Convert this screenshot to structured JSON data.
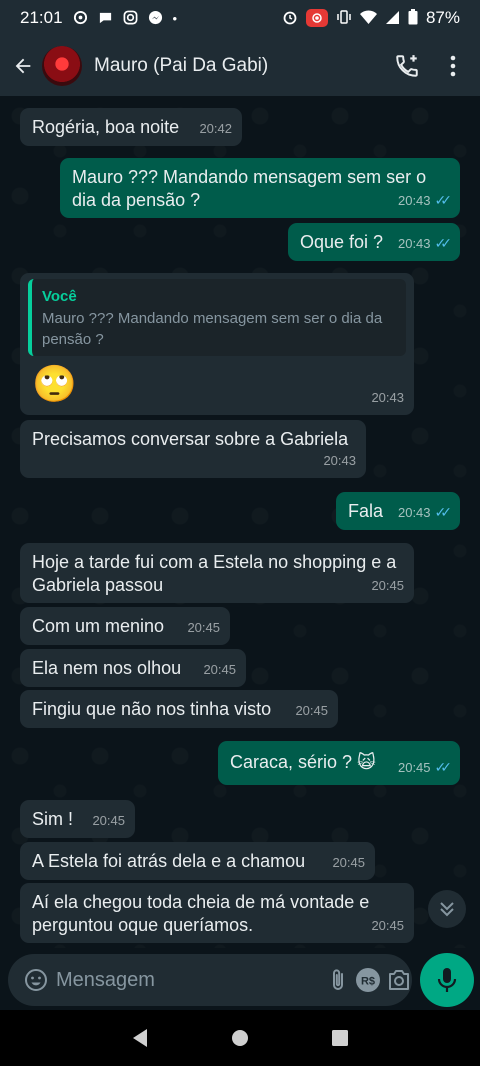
{
  "status_bar": {
    "time": "21:01",
    "battery": "87%"
  },
  "header": {
    "contact_name": "Mauro (Pai Da Gabi)"
  },
  "messages": [
    {
      "dir": "in",
      "text": "Rogéria, boa noite",
      "time": "20:42"
    },
    {
      "dir": "out",
      "text": "Mauro ??? Mandando mensagem sem ser o dia da pensão ?",
      "time": "20:43",
      "read": true
    },
    {
      "dir": "out",
      "text": "Oque foi ?",
      "time": "20:43",
      "read": true
    },
    {
      "dir": "in",
      "quote_author": "Você",
      "quote_text": "Mauro ??? Mandando mensagem sem ser o dia da pensão ?",
      "text": "🙄",
      "time": "20:43"
    },
    {
      "dir": "in",
      "text": "Precisamos conversar sobre a Gabriela",
      "time": "20:43"
    },
    {
      "dir": "out",
      "text": "Fala",
      "time": "20:43",
      "read": true
    },
    {
      "dir": "in",
      "text": "Hoje a tarde fui com a Estela no shopping e a Gabriela passou",
      "time": "20:45"
    },
    {
      "dir": "in",
      "text": "Com um menino",
      "time": "20:45"
    },
    {
      "dir": "in",
      "text": "Ela nem nos olhou",
      "time": "20:45"
    },
    {
      "dir": "in",
      "text": "Fingiu que não nos tinha visto",
      "time": "20:45"
    },
    {
      "dir": "out",
      "text": "Caraca, sério ? 🙀",
      "time": "20:45",
      "read": true
    },
    {
      "dir": "in",
      "text": "Sim !",
      "time": "20:45"
    },
    {
      "dir": "in",
      "text": "A Estela foi atrás dela e a chamou",
      "time": "20:45"
    },
    {
      "dir": "in",
      "text": "Aí ela chegou toda cheia de má vontade e perguntou oque queríamos.",
      "time": "20:45"
    }
  ],
  "composer": {
    "placeholder": "Mensagem",
    "payment_label": "R$"
  },
  "colors": {
    "incoming": "#202c33",
    "outgoing": "#005c4b",
    "accent": "#00a884",
    "read_ticks": "#53bdeb"
  }
}
